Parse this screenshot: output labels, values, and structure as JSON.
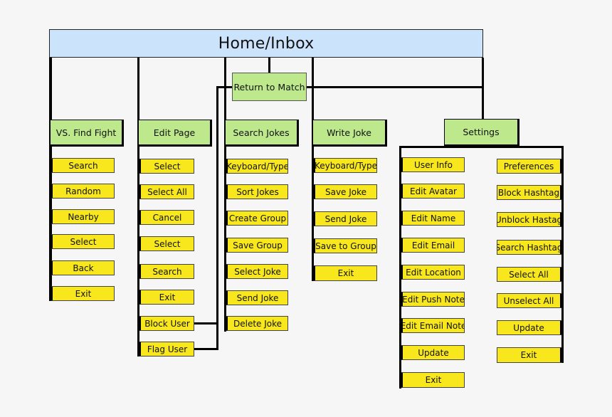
{
  "title": "Home/Inbox",
  "return_to_match": "Return to Match",
  "sections": [
    {
      "label": "VS. Find Fight",
      "items": [
        "Search",
        "Random",
        "Nearby",
        "Select",
        "Back",
        "Exit"
      ]
    },
    {
      "label": "Edit Page",
      "items": [
        "Select",
        "Select All",
        "Cancel",
        "Select",
        "Search",
        "Exit",
        "Block User",
        "Flag User"
      ]
    },
    {
      "label": "Search Jokes",
      "items": [
        "Keyboard/Type",
        "Sort Jokes",
        "Create Group",
        "Save Group",
        "Select Joke",
        "Send Joke",
        "Delete Joke"
      ]
    },
    {
      "label": "Write Joke",
      "items": [
        "Keyboard/Type",
        "Save Joke",
        "Send Joke",
        "Save to Group",
        "Exit"
      ]
    },
    {
      "label": "Settings",
      "left_items": [
        "User Info",
        "Edit Avatar",
        "Edit Name",
        "Edit Email",
        "Edit Location",
        "Edit Push Note",
        "Edit Email Note",
        "Update",
        "Exit"
      ],
      "right_items": [
        "Preferences",
        "Block Hashtag",
        "Unblock Hastag",
        "Search Hashtag",
        "Select All",
        "Unselect All",
        "Update",
        "Exit"
      ]
    }
  ],
  "colors": {
    "header": "#cce4fb",
    "section": "#bde88c",
    "item": "#f8e71c",
    "background": "#f6f6f6"
  }
}
